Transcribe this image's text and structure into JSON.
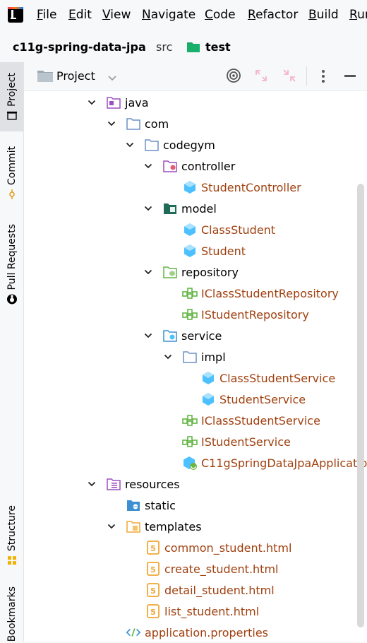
{
  "menubar": {
    "items": [
      {
        "label": "File",
        "u": "F",
        "rest": "ile"
      },
      {
        "label": "Edit",
        "u": "E",
        "rest": "dit"
      },
      {
        "label": "View",
        "u": "V",
        "rest": "iew"
      },
      {
        "label": "Navigate",
        "u": "N",
        "rest": "avigate"
      },
      {
        "label": "Code",
        "u": "C",
        "rest": "ode"
      },
      {
        "label": "Refactor",
        "u": "R",
        "rest": "efactor"
      },
      {
        "label": "Build",
        "u": "B",
        "rest": "uild"
      },
      {
        "label": "Run",
        "u": "R",
        "rest": "un"
      }
    ]
  },
  "breadcrumb": {
    "project": "c11g-spring-data-jpa",
    "folder": "src",
    "leaf": "test"
  },
  "leftstrip": {
    "tabs": [
      "Project",
      "Commit",
      "Pull Requests",
      "Structure",
      "Bookmarks"
    ]
  },
  "panel": {
    "title": "Project"
  },
  "tree": [
    {
      "label": "java",
      "icon": "source-folder-icon",
      "chev": "down",
      "color_class": "t-dir"
    },
    {
      "label": "com",
      "icon": "folder-icon",
      "chev": "down",
      "color_class": "t-dir"
    },
    {
      "label": "codegym",
      "icon": "folder-icon",
      "chev": "down",
      "color_class": "t-dir"
    },
    {
      "label": "controller",
      "icon": "controller-package-icon",
      "chev": "down",
      "color_class": "t-dir"
    },
    {
      "label": "StudentController",
      "icon": "class-icon",
      "chev": "none",
      "color_class": "t-src"
    },
    {
      "label": "model",
      "icon": "model-package-icon",
      "chev": "down",
      "color_class": "t-dir"
    },
    {
      "label": "ClassStudent",
      "icon": "class-icon",
      "chev": "none",
      "color_class": "t-src"
    },
    {
      "label": "Student",
      "icon": "class-icon",
      "chev": "none",
      "color_class": "t-src"
    },
    {
      "label": "repository",
      "icon": "repository-package-icon",
      "chev": "down",
      "color_class": "t-dir"
    },
    {
      "label": "IClassStudentRepository",
      "icon": "interface-icon",
      "chev": "none",
      "color_class": "t-src"
    },
    {
      "label": "IStudentRepository",
      "icon": "interface-icon",
      "chev": "none",
      "color_class": "t-src"
    },
    {
      "label": "service",
      "icon": "service-package-icon",
      "chev": "down",
      "color_class": "t-dir"
    },
    {
      "label": "impl",
      "icon": "folder-icon",
      "chev": "down",
      "color_class": "t-dir"
    },
    {
      "label": "ClassStudentService",
      "icon": "class-icon",
      "chev": "none",
      "color_class": "t-src"
    },
    {
      "label": "StudentService",
      "icon": "class-icon",
      "chev": "none",
      "color_class": "t-src"
    },
    {
      "label": "IClassStudentService",
      "icon": "interface-icon",
      "chev": "none",
      "color_class": "t-src"
    },
    {
      "label": "IStudentService",
      "icon": "interface-icon",
      "chev": "none",
      "color_class": "t-src"
    },
    {
      "label": "C11gSpringDataJpaApplicatio",
      "icon": "spring-app-icon",
      "chev": "none",
      "color_class": "t-src"
    },
    {
      "label": "resources",
      "icon": "resources-folder-icon",
      "chev": "down",
      "color_class": "t-dir"
    },
    {
      "label": "static",
      "icon": "web-folder-icon",
      "chev": "none",
      "color_class": "t-dir"
    },
    {
      "label": "templates",
      "icon": "templates-folder-icon",
      "chev": "down",
      "color_class": "t-dir"
    },
    {
      "label": "common_student.html",
      "icon": "html-icon",
      "chev": "none",
      "color_class": "t-src"
    },
    {
      "label": "create_student.html",
      "icon": "html-icon",
      "chev": "none",
      "color_class": "t-src"
    },
    {
      "label": "detail_student.html",
      "icon": "html-icon",
      "chev": "none",
      "color_class": "t-src"
    },
    {
      "label": "list_student.html",
      "icon": "html-icon",
      "chev": "none",
      "color_class": "t-src"
    },
    {
      "label": "application.properties",
      "icon": "properties-icon",
      "chev": "none",
      "color_class": "t-src"
    }
  ],
  "colors": {
    "source_text": "#a0400f",
    "class_icon": "#4dc1ff",
    "interface_icon": "#62b543",
    "html_icon": "#f0a732"
  }
}
